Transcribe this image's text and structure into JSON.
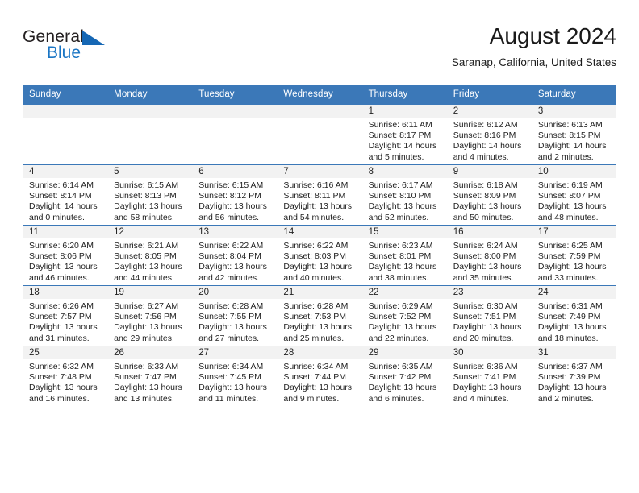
{
  "brand": {
    "name_part1": "General",
    "name_part2": "Blue",
    "color_dark": "#231f20",
    "color_blue": "#1a75c4"
  },
  "header": {
    "title": "August 2024",
    "subtitle": "Saranap, California, United States"
  },
  "theme": {
    "header_bg": "#3b78b8",
    "header_text": "#ffffff",
    "daynum_bg": "#f2f2f2",
    "cell_bg": "#ffffff",
    "grid_line": "#3b78b8"
  },
  "columns": [
    "Sunday",
    "Monday",
    "Tuesday",
    "Wednesday",
    "Thursday",
    "Friday",
    "Saturday"
  ],
  "weeks": [
    [
      {
        "day": "",
        "sunrise": "",
        "sunset": "",
        "daylight1": "",
        "daylight2": ""
      },
      {
        "day": "",
        "sunrise": "",
        "sunset": "",
        "daylight1": "",
        "daylight2": ""
      },
      {
        "day": "",
        "sunrise": "",
        "sunset": "",
        "daylight1": "",
        "daylight2": ""
      },
      {
        "day": "",
        "sunrise": "",
        "sunset": "",
        "daylight1": "",
        "daylight2": ""
      },
      {
        "day": "1",
        "sunrise": "Sunrise: 6:11 AM",
        "sunset": "Sunset: 8:17 PM",
        "daylight1": "Daylight: 14 hours",
        "daylight2": "and 5 minutes."
      },
      {
        "day": "2",
        "sunrise": "Sunrise: 6:12 AM",
        "sunset": "Sunset: 8:16 PM",
        "daylight1": "Daylight: 14 hours",
        "daylight2": "and 4 minutes."
      },
      {
        "day": "3",
        "sunrise": "Sunrise: 6:13 AM",
        "sunset": "Sunset: 8:15 PM",
        "daylight1": "Daylight: 14 hours",
        "daylight2": "and 2 minutes."
      }
    ],
    [
      {
        "day": "4",
        "sunrise": "Sunrise: 6:14 AM",
        "sunset": "Sunset: 8:14 PM",
        "daylight1": "Daylight: 14 hours",
        "daylight2": "and 0 minutes."
      },
      {
        "day": "5",
        "sunrise": "Sunrise: 6:15 AM",
        "sunset": "Sunset: 8:13 PM",
        "daylight1": "Daylight: 13 hours",
        "daylight2": "and 58 minutes."
      },
      {
        "day": "6",
        "sunrise": "Sunrise: 6:15 AM",
        "sunset": "Sunset: 8:12 PM",
        "daylight1": "Daylight: 13 hours",
        "daylight2": "and 56 minutes."
      },
      {
        "day": "7",
        "sunrise": "Sunrise: 6:16 AM",
        "sunset": "Sunset: 8:11 PM",
        "daylight1": "Daylight: 13 hours",
        "daylight2": "and 54 minutes."
      },
      {
        "day": "8",
        "sunrise": "Sunrise: 6:17 AM",
        "sunset": "Sunset: 8:10 PM",
        "daylight1": "Daylight: 13 hours",
        "daylight2": "and 52 minutes."
      },
      {
        "day": "9",
        "sunrise": "Sunrise: 6:18 AM",
        "sunset": "Sunset: 8:09 PM",
        "daylight1": "Daylight: 13 hours",
        "daylight2": "and 50 minutes."
      },
      {
        "day": "10",
        "sunrise": "Sunrise: 6:19 AM",
        "sunset": "Sunset: 8:07 PM",
        "daylight1": "Daylight: 13 hours",
        "daylight2": "and 48 minutes."
      }
    ],
    [
      {
        "day": "11",
        "sunrise": "Sunrise: 6:20 AM",
        "sunset": "Sunset: 8:06 PM",
        "daylight1": "Daylight: 13 hours",
        "daylight2": "and 46 minutes."
      },
      {
        "day": "12",
        "sunrise": "Sunrise: 6:21 AM",
        "sunset": "Sunset: 8:05 PM",
        "daylight1": "Daylight: 13 hours",
        "daylight2": "and 44 minutes."
      },
      {
        "day": "13",
        "sunrise": "Sunrise: 6:22 AM",
        "sunset": "Sunset: 8:04 PM",
        "daylight1": "Daylight: 13 hours",
        "daylight2": "and 42 minutes."
      },
      {
        "day": "14",
        "sunrise": "Sunrise: 6:22 AM",
        "sunset": "Sunset: 8:03 PM",
        "daylight1": "Daylight: 13 hours",
        "daylight2": "and 40 minutes."
      },
      {
        "day": "15",
        "sunrise": "Sunrise: 6:23 AM",
        "sunset": "Sunset: 8:01 PM",
        "daylight1": "Daylight: 13 hours",
        "daylight2": "and 38 minutes."
      },
      {
        "day": "16",
        "sunrise": "Sunrise: 6:24 AM",
        "sunset": "Sunset: 8:00 PM",
        "daylight1": "Daylight: 13 hours",
        "daylight2": "and 35 minutes."
      },
      {
        "day": "17",
        "sunrise": "Sunrise: 6:25 AM",
        "sunset": "Sunset: 7:59 PM",
        "daylight1": "Daylight: 13 hours",
        "daylight2": "and 33 minutes."
      }
    ],
    [
      {
        "day": "18",
        "sunrise": "Sunrise: 6:26 AM",
        "sunset": "Sunset: 7:57 PM",
        "daylight1": "Daylight: 13 hours",
        "daylight2": "and 31 minutes."
      },
      {
        "day": "19",
        "sunrise": "Sunrise: 6:27 AM",
        "sunset": "Sunset: 7:56 PM",
        "daylight1": "Daylight: 13 hours",
        "daylight2": "and 29 minutes."
      },
      {
        "day": "20",
        "sunrise": "Sunrise: 6:28 AM",
        "sunset": "Sunset: 7:55 PM",
        "daylight1": "Daylight: 13 hours",
        "daylight2": "and 27 minutes."
      },
      {
        "day": "21",
        "sunrise": "Sunrise: 6:28 AM",
        "sunset": "Sunset: 7:53 PM",
        "daylight1": "Daylight: 13 hours",
        "daylight2": "and 25 minutes."
      },
      {
        "day": "22",
        "sunrise": "Sunrise: 6:29 AM",
        "sunset": "Sunset: 7:52 PM",
        "daylight1": "Daylight: 13 hours",
        "daylight2": "and 22 minutes."
      },
      {
        "day": "23",
        "sunrise": "Sunrise: 6:30 AM",
        "sunset": "Sunset: 7:51 PM",
        "daylight1": "Daylight: 13 hours",
        "daylight2": "and 20 minutes."
      },
      {
        "day": "24",
        "sunrise": "Sunrise: 6:31 AM",
        "sunset": "Sunset: 7:49 PM",
        "daylight1": "Daylight: 13 hours",
        "daylight2": "and 18 minutes."
      }
    ],
    [
      {
        "day": "25",
        "sunrise": "Sunrise: 6:32 AM",
        "sunset": "Sunset: 7:48 PM",
        "daylight1": "Daylight: 13 hours",
        "daylight2": "and 16 minutes."
      },
      {
        "day": "26",
        "sunrise": "Sunrise: 6:33 AM",
        "sunset": "Sunset: 7:47 PM",
        "daylight1": "Daylight: 13 hours",
        "daylight2": "and 13 minutes."
      },
      {
        "day": "27",
        "sunrise": "Sunrise: 6:34 AM",
        "sunset": "Sunset: 7:45 PM",
        "daylight1": "Daylight: 13 hours",
        "daylight2": "and 11 minutes."
      },
      {
        "day": "28",
        "sunrise": "Sunrise: 6:34 AM",
        "sunset": "Sunset: 7:44 PM",
        "daylight1": "Daylight: 13 hours",
        "daylight2": "and 9 minutes."
      },
      {
        "day": "29",
        "sunrise": "Sunrise: 6:35 AM",
        "sunset": "Sunset: 7:42 PM",
        "daylight1": "Daylight: 13 hours",
        "daylight2": "and 6 minutes."
      },
      {
        "day": "30",
        "sunrise": "Sunrise: 6:36 AM",
        "sunset": "Sunset: 7:41 PM",
        "daylight1": "Daylight: 13 hours",
        "daylight2": "and 4 minutes."
      },
      {
        "day": "31",
        "sunrise": "Sunrise: 6:37 AM",
        "sunset": "Sunset: 7:39 PM",
        "daylight1": "Daylight: 13 hours",
        "daylight2": "and 2 minutes."
      }
    ]
  ]
}
